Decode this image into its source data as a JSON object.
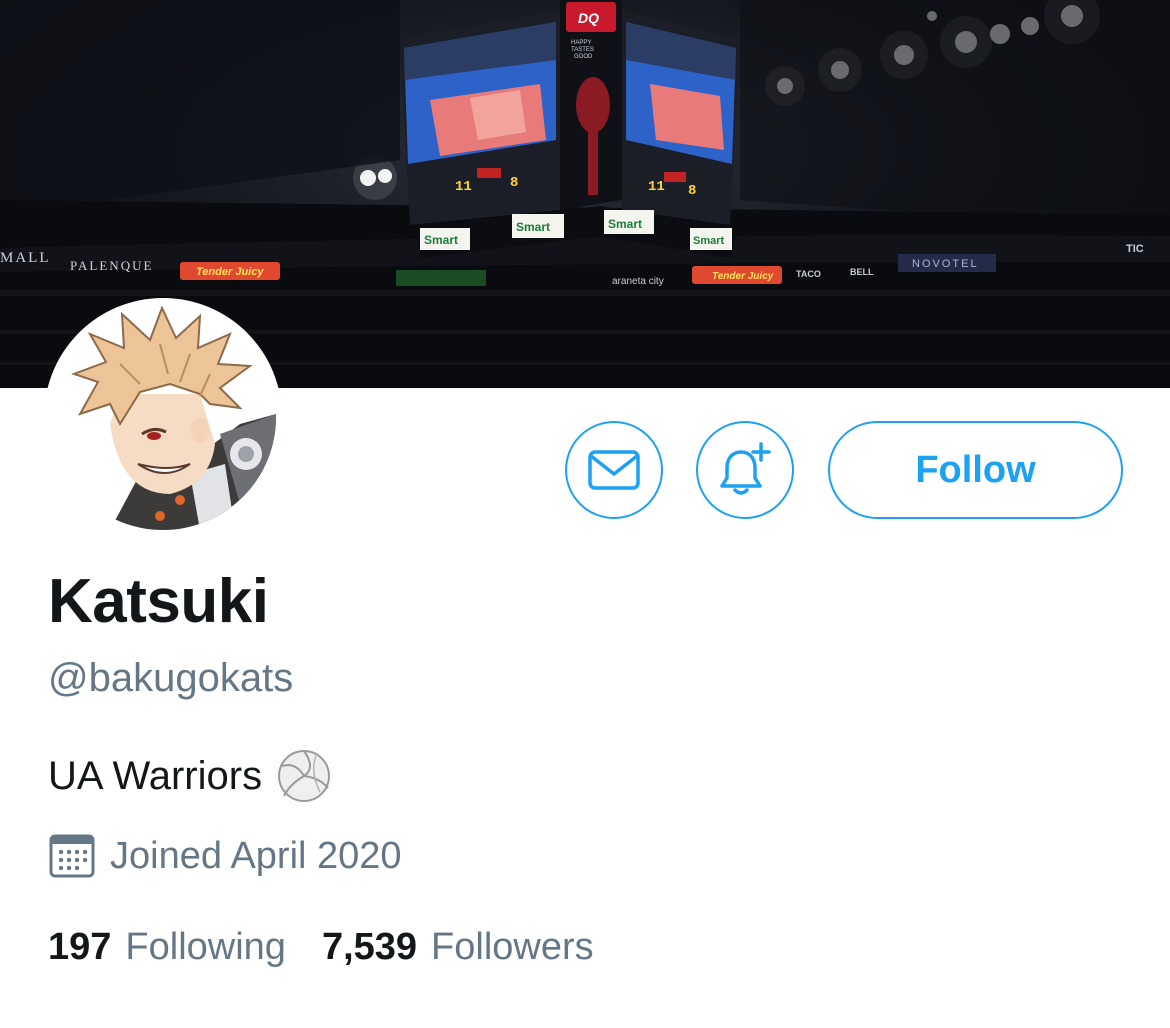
{
  "banner": {
    "scoreboard_top_brand": "DQ",
    "scoreboard_top_tagline": "HAPPY TASTES GOOD",
    "scoreboard_ads": [
      "Smart",
      "Smart",
      "Smart",
      "Smart"
    ],
    "arena_ring_signs": [
      "MALL",
      "PALENQUE",
      "Tender Juicy",
      "araneta city",
      "Tender Juicy",
      "TACO BELL",
      "NOVOTEL",
      "TIC"
    ],
    "score_left": "11",
    "score_right": "8"
  },
  "avatar": {
    "icon": "anime-avatar"
  },
  "actions": {
    "message_icon": "envelope-icon",
    "notify_icon": "bell-plus-icon",
    "follow_label": "Follow"
  },
  "profile": {
    "display_name": "Katsuki",
    "handle": "@bakugokats",
    "bio": "UA Warriors",
    "bio_emoji": "volleyball",
    "joined": "Joined April 2020"
  },
  "stats": {
    "following_count": "197",
    "following_label": "Following",
    "followers_count": "7,539",
    "followers_label": "Followers"
  },
  "colors": {
    "accent": "#1da1f2",
    "secondary_text": "#657786",
    "primary_text": "#14171a"
  }
}
